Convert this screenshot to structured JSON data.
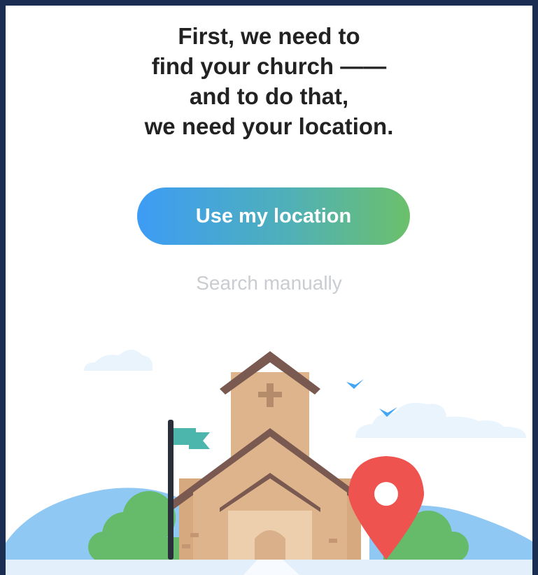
{
  "headline": {
    "line1": "First, we need to",
    "line2": "find your church ——",
    "line3": "and to do that,",
    "line4": "we need your location."
  },
  "actions": {
    "use_location_label": "Use my location",
    "search_manually_label": "Search manually"
  },
  "colors": {
    "frame": "#1b2d52",
    "button_gradient_start": "#3d9cf5",
    "button_gradient_end": "#6cc06b",
    "pin": "#ee5350",
    "flag": "#4db6ac",
    "church_wall": "#deb48c",
    "church_roof": "#7a5a50"
  },
  "illustration": {
    "icons": [
      "church-icon",
      "location-pin-icon",
      "flag-icon",
      "bird-icon",
      "cloud-icon",
      "hills-icon",
      "bush-icon"
    ]
  }
}
